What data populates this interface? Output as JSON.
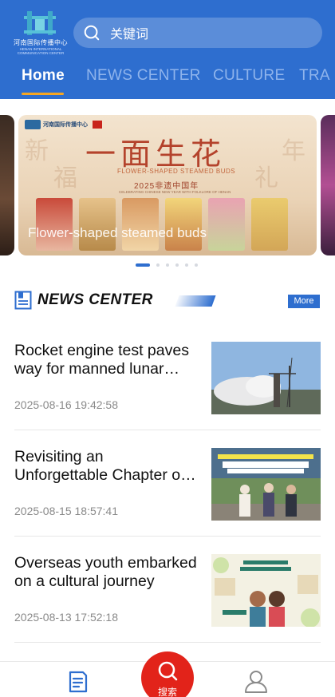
{
  "header": {
    "logo_cn": "河南国际传播中心",
    "logo_en_line1": "HENAN INTERNATIONAL",
    "logo_en_line2": "COMMUNICATION CENTER",
    "search_placeholder": "关键词",
    "tabs": [
      {
        "label": "Home",
        "active": true
      },
      {
        "label": "NEWS CENTER",
        "active": false
      },
      {
        "label": "CULTURE",
        "active": false
      },
      {
        "label": "TRA",
        "active": false
      }
    ]
  },
  "carousel": {
    "brand": "河南国际传播中心",
    "slide_title_cn": "一面生花",
    "slide_subtitle_en": "FLOWER-SHAPED STEAMED BUDS",
    "slide_year": "2025非遗中国年",
    "slide_year_en": "CELEBRATING CHINESE NEW YEAR WITH FOLKLORE OF HENAN",
    "caption": "Flower-shaped steamed buds",
    "dots_count": 7,
    "active_dot": 0
  },
  "section": {
    "title": "NEWS CENTER",
    "more_label": "More"
  },
  "news": [
    {
      "title": "Rocket engine test paves way for manned lunar landing",
      "date": "2025-08-16 19:42:58",
      "thumb": "rocket-launch"
    },
    {
      "title": "Revisiting an Unforgettable Chapter of History",
      "date": "2025-08-15 18:57:41",
      "thumb": "people-outdoor"
    },
    {
      "title": "Overseas youth embarked on a cultural journey",
      "date": "2025-08-13 17:52:18",
      "thumb": "cartoon-poster"
    }
  ],
  "bottom_nav": {
    "search_label": "搜索"
  },
  "colors": {
    "brand_blue": "#2e6ecf",
    "accent_orange": "#f5a623",
    "search_red": "#e2231a"
  }
}
